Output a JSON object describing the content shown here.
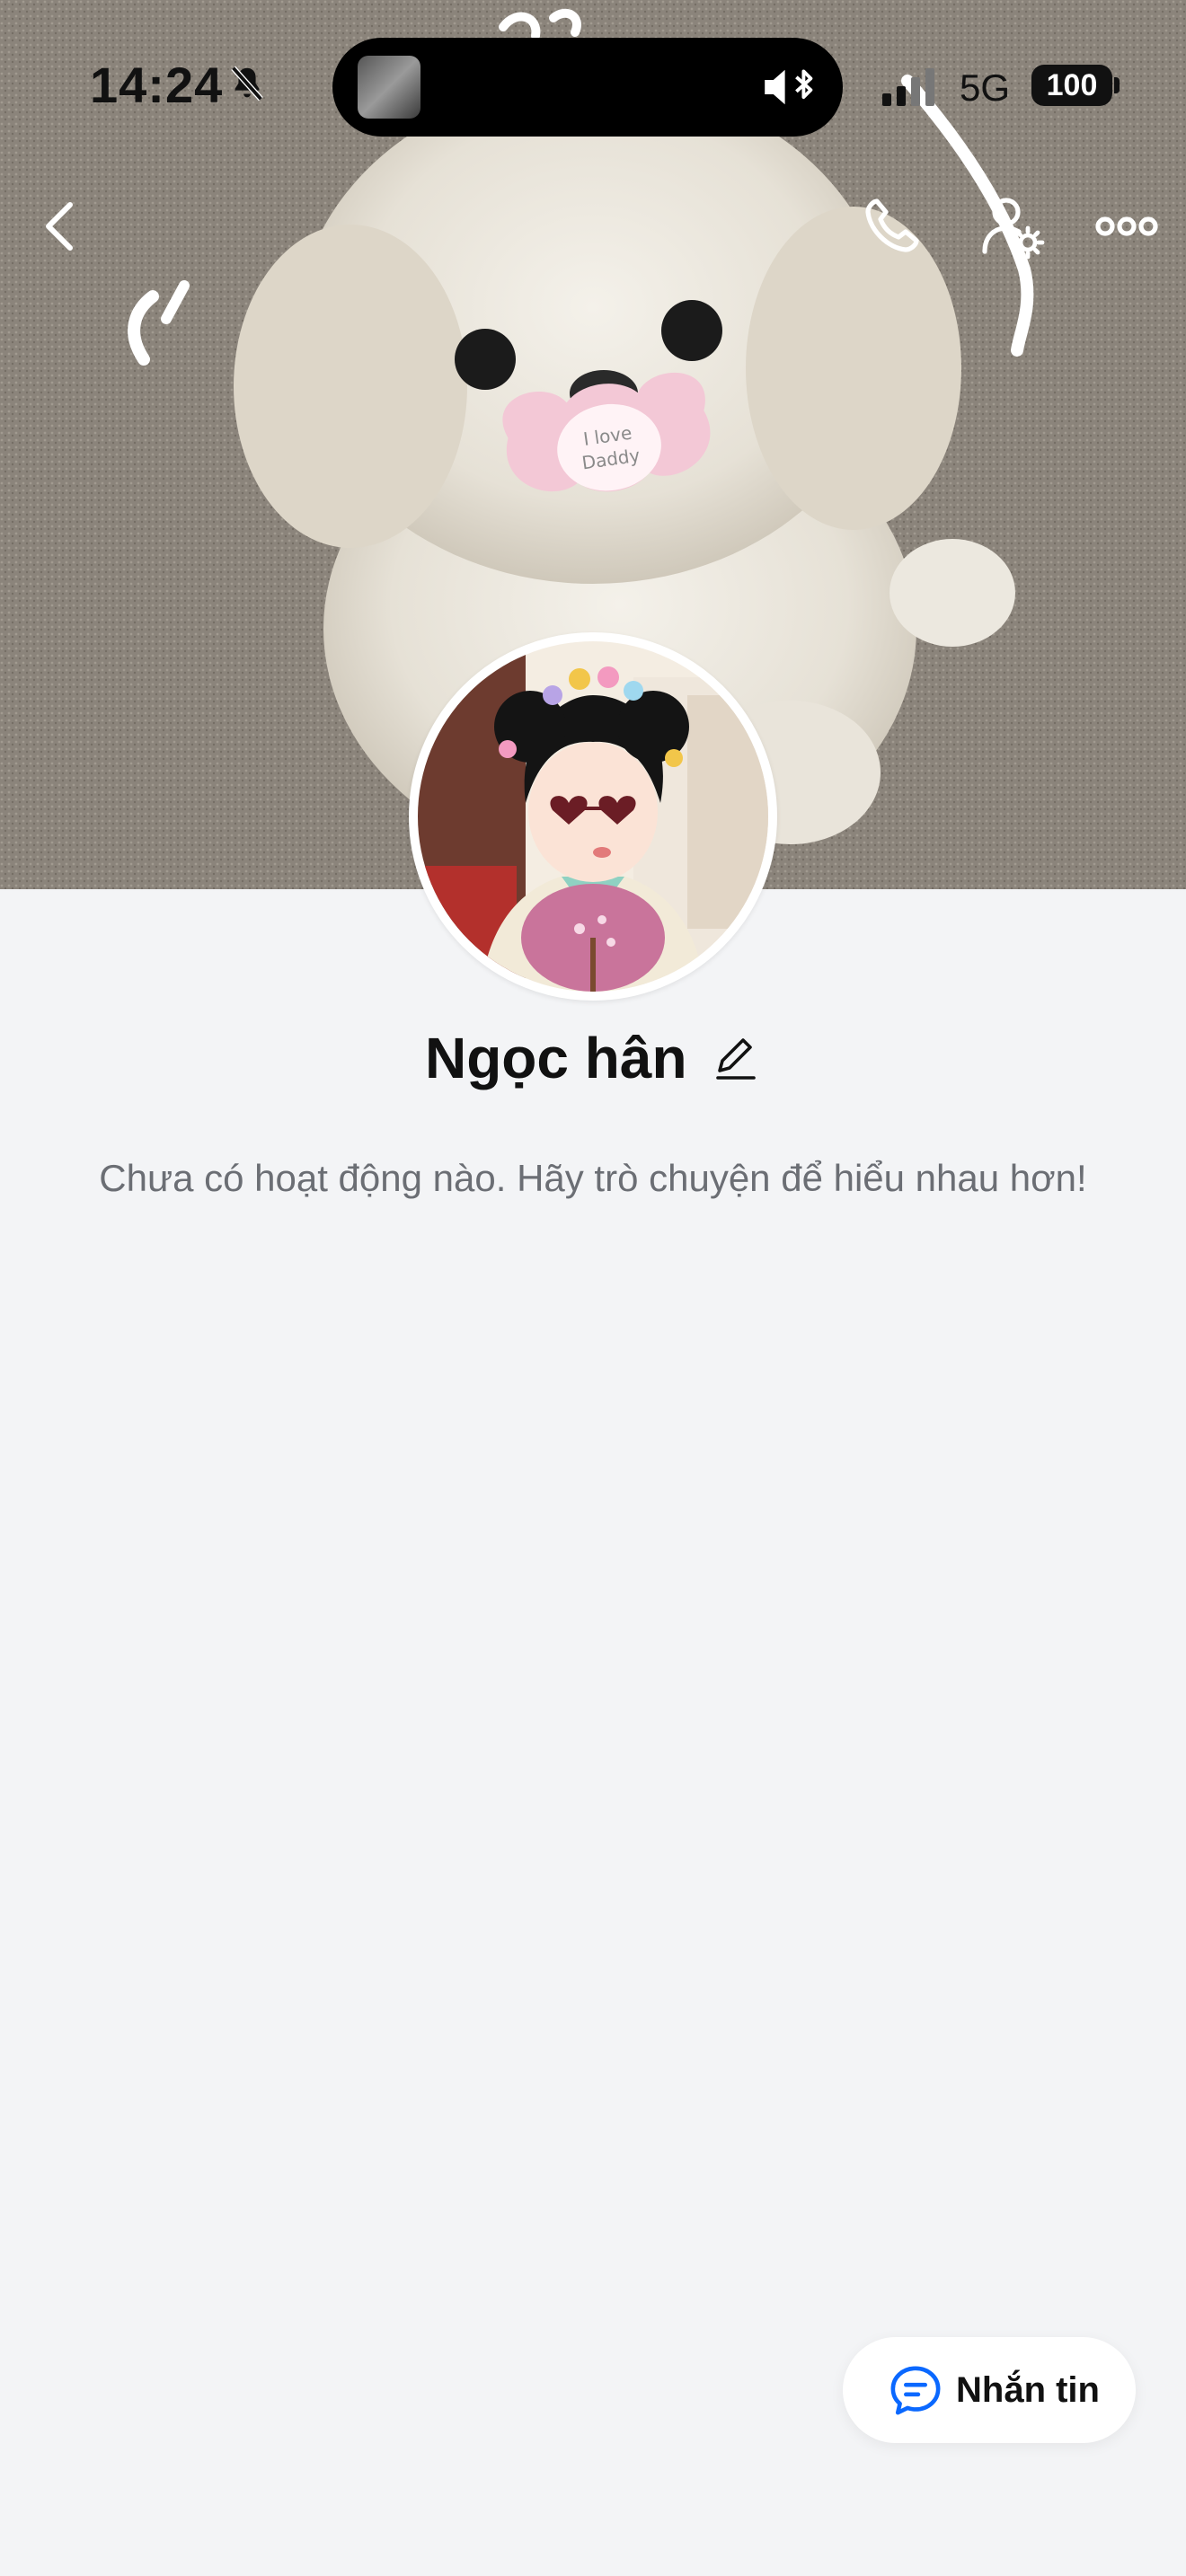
{
  "status_bar": {
    "time": "14:24",
    "network": "5G",
    "battery": "100"
  },
  "icons": {
    "back": "back-chevron-icon",
    "call": "phone-icon",
    "profile_settings": "user-gear-icon",
    "more": "more-dots-icon",
    "edit": "pencil-icon",
    "message": "chat-bubble-icon",
    "bell_off": "bell-slash-icon"
  },
  "profile": {
    "name": "Ngọc hân",
    "empty_activity_text": "Chưa có hoạt động nào. Hãy trò chuyện để hiểu nhau hơn!"
  },
  "actions": {
    "message_label": "Nhắn tin"
  },
  "colors": {
    "background": "#f3f4f6",
    "accent": "#0a68ff",
    "text_primary": "#111111",
    "text_secondary": "#6b6e74"
  }
}
